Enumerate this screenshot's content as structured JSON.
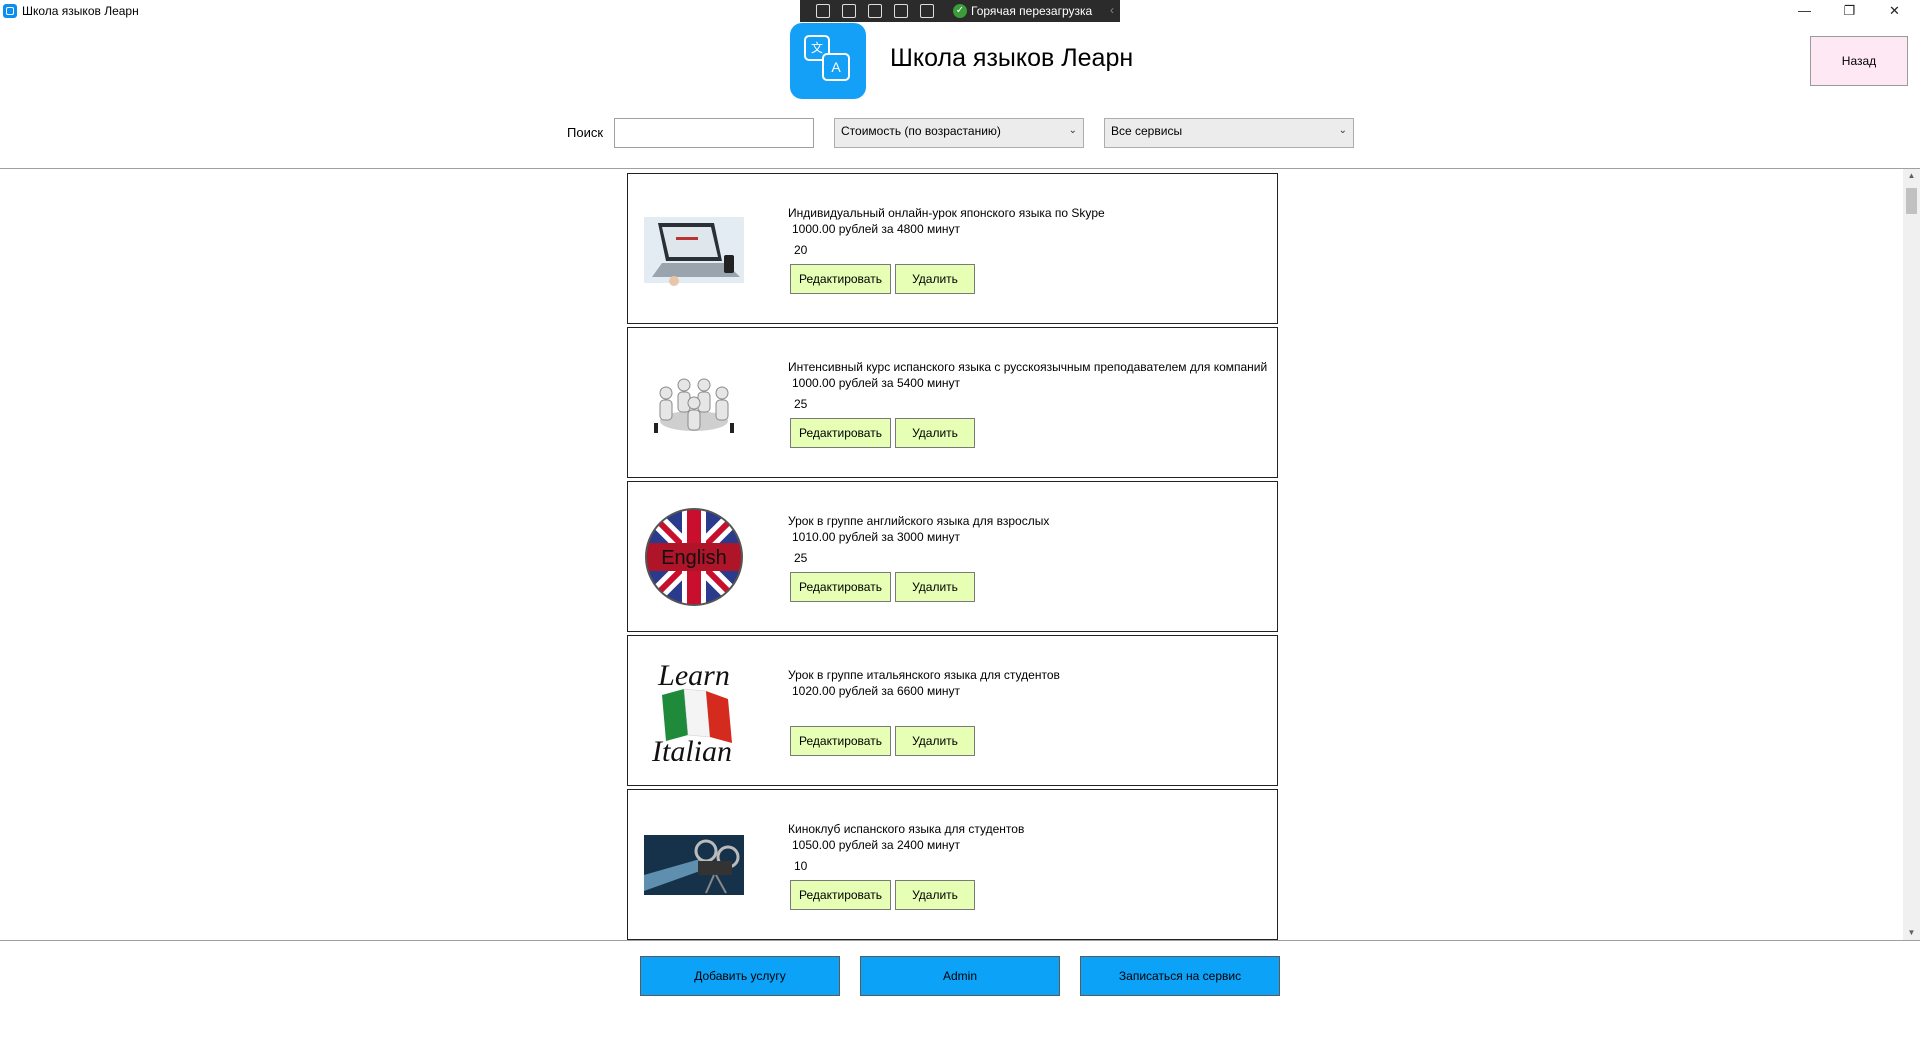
{
  "window": {
    "title": "Школа языков Леарн",
    "minimize": "—",
    "maximize": "❐",
    "close": "✕"
  },
  "debug_toolbar": {
    "hot_reload_label": "Горячая перезагрузка",
    "check": "✓",
    "collapse": "‹"
  },
  "header": {
    "title": "Школа языков Леарн",
    "logo_glyph_1": "文",
    "logo_glyph_2": "A",
    "back_label": "Назад"
  },
  "filters": {
    "search_label": "Поиск",
    "search_value": "",
    "sort_selected": "Стоимость (по возрастанию)",
    "category_selected": "Все сервисы",
    "arrow": "⌄"
  },
  "services": [
    {
      "title": "Индивидуальный онлайн-урок японского языка по Skype",
      "price_line": "1000.00 рублей за 4800 минут",
      "discount": "20",
      "image": "laptop-photo"
    },
    {
      "title": "Интенсивный курс испанского языка с русскоязычным преподавателем для компаний",
      "price_line": "1000.00 рублей за 5400 минут",
      "discount": "25",
      "image": "people-meeting-photo"
    },
    {
      "title": "Урок в группе английского языка для взрослых",
      "price_line": "1010.00 рублей за 3000 минут",
      "discount": "25",
      "image": "english-flag-badge",
      "image_text": "English"
    },
    {
      "title": "Урок в группе итальянского языка для студентов",
      "price_line": "1020.00 рублей за 6600 минут",
      "discount": "",
      "image": "learn-italian-flag",
      "image_text_1": "Learn",
      "image_text_2": "Italian"
    },
    {
      "title": "Киноклуб испанского языка для студентов",
      "price_line": "1050.00 рублей за 2400 минут",
      "discount": "10",
      "image": "film-projector-photo"
    }
  ],
  "card_buttons": {
    "edit": "Редактировать",
    "delete": "Удалить"
  },
  "scrollbar": {
    "up": "▲",
    "down": "▼"
  },
  "footer": {
    "add_service": "Добавить услугу",
    "admin": "Admin",
    "book_service": "Записаться на сервис"
  },
  "colors": {
    "accent": "#0ba2f8",
    "card_button": "#e6ffb4",
    "back_button": "#fde8f4"
  }
}
